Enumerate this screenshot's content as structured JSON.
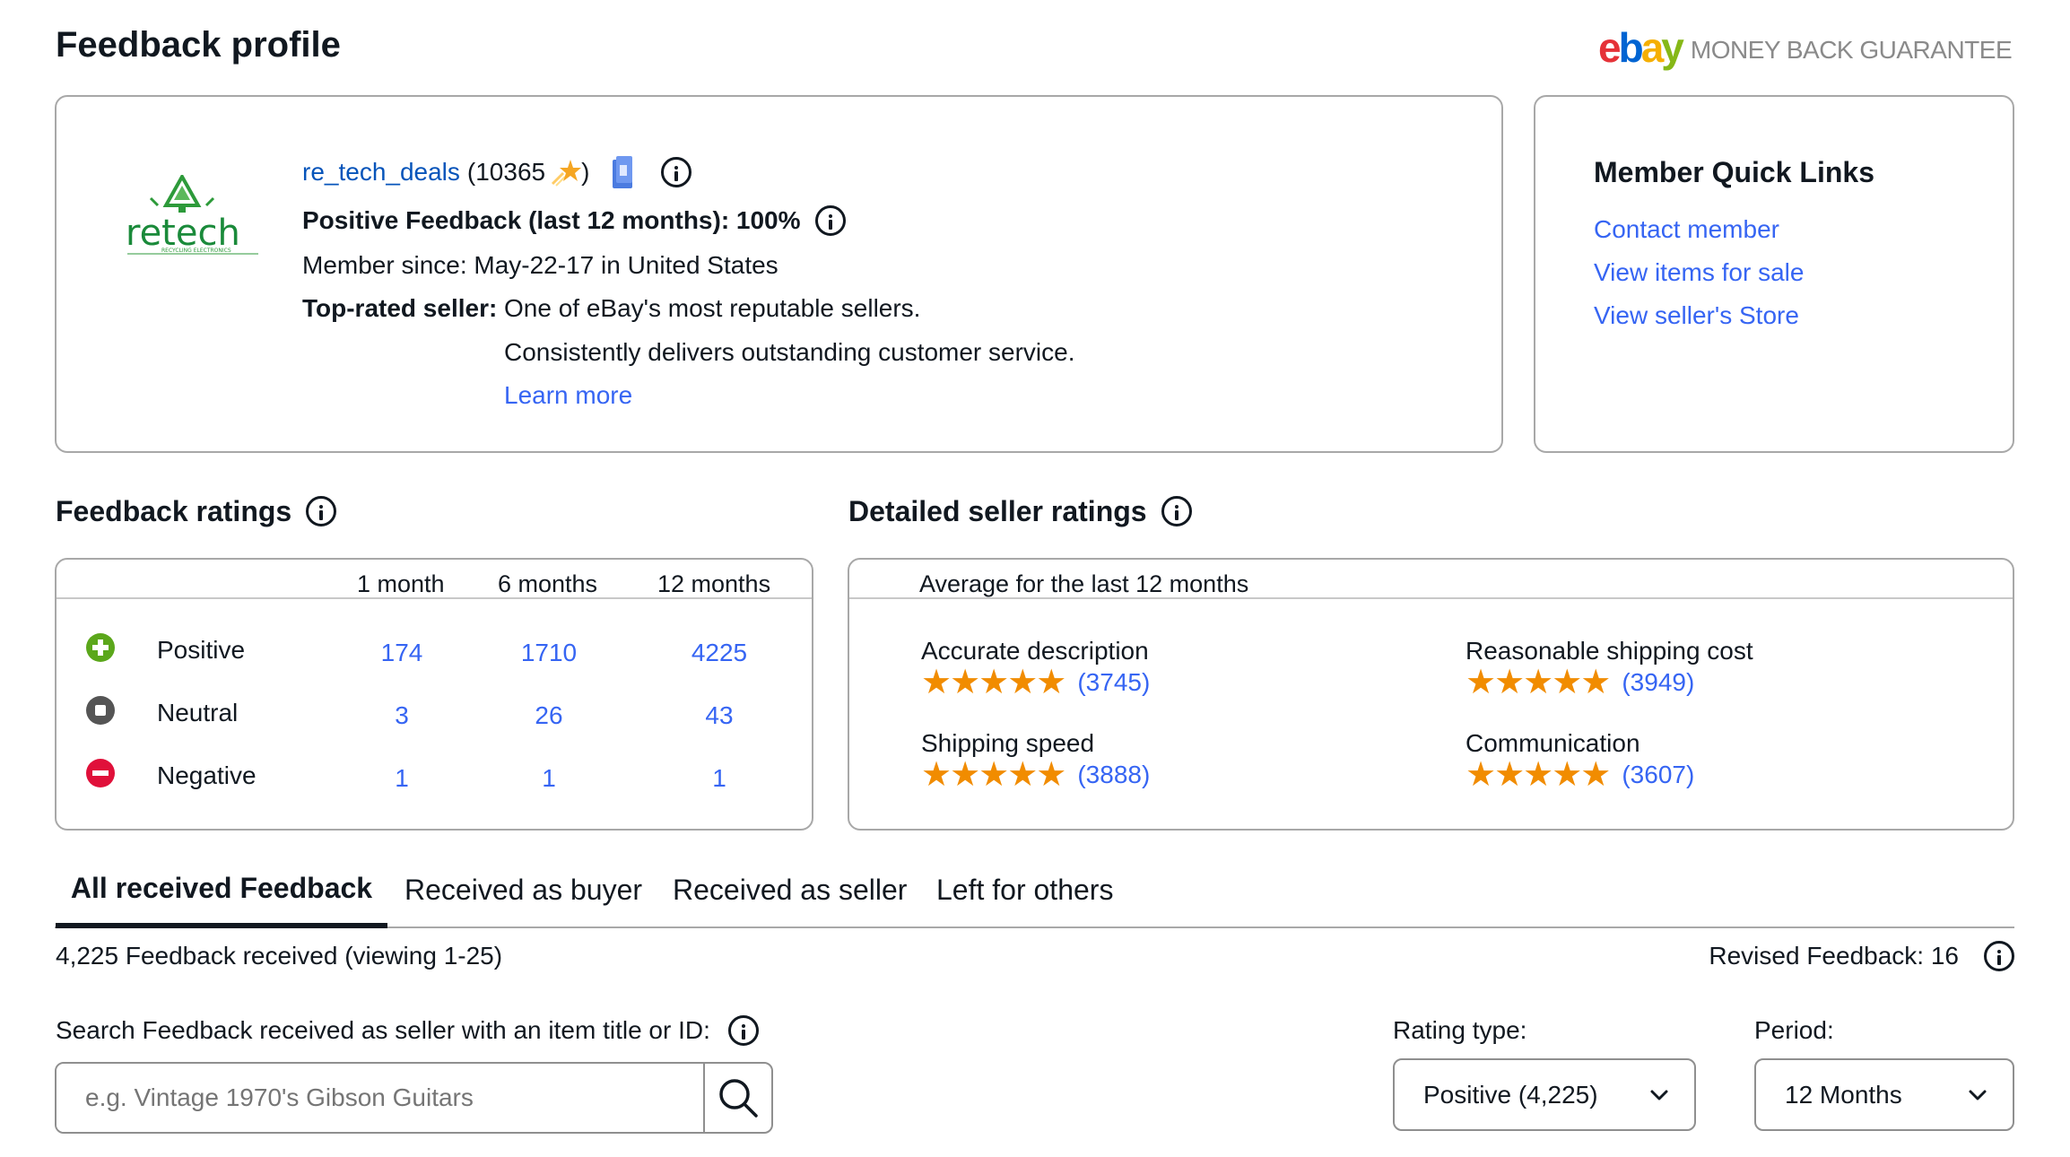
{
  "page_title": "Feedback profile",
  "banner": {
    "brand_letters": [
      "e",
      "b",
      "a",
      "y"
    ],
    "brand_colors": [
      "#e53238",
      "#0064d2",
      "#f5af02",
      "#86b817"
    ],
    "tagline": "MONEY BACK GUARANTEE"
  },
  "profile": {
    "logo_text": "retech",
    "logo_subtext": "RECYCLING ELECTRONICS",
    "username": "re_tech_deals",
    "score_open": "(10365",
    "score_close": ")",
    "positive_feedback": "Positive Feedback (last 12 months): 100%",
    "member_since": "Member since: May-22-17 in United States",
    "top_rated_label": "Top-rated seller:",
    "top_rated_line1": "One of eBay's most reputable sellers.",
    "top_rated_line2": "Consistently delivers outstanding customer service.",
    "learn_more": "Learn more"
  },
  "quick_links": {
    "title": "Member Quick Links",
    "items": [
      "Contact member",
      "View items for sale",
      "View seller's Store"
    ]
  },
  "feedback_ratings": {
    "title": "Feedback ratings",
    "columns": [
      "1 month",
      "6 months",
      "12 months"
    ],
    "rows": [
      {
        "label": "Positive",
        "values": [
          "174",
          "1710",
          "4225"
        ],
        "color": "#5ba71b"
      },
      {
        "label": "Neutral",
        "values": [
          "3",
          "26",
          "43"
        ],
        "color": "#555555"
      },
      {
        "label": "Negative",
        "values": [
          "1",
          "1",
          "1"
        ],
        "color": "#e0103a"
      }
    ]
  },
  "detailed_ratings": {
    "title": "Detailed seller ratings",
    "subtitle": "Average for the last 12 months",
    "items": [
      {
        "label": "Accurate description",
        "count": "(3745)",
        "stars": 5
      },
      {
        "label": "Reasonable shipping cost",
        "count": "(3949)",
        "stars": 5
      },
      {
        "label": "Shipping speed",
        "count": "(3888)",
        "stars": 5
      },
      {
        "label": "Communication",
        "count": "(3607)",
        "stars": 5
      }
    ]
  },
  "tabs": [
    "All received Feedback",
    "Received as buyer",
    "Received as seller",
    "Left for others"
  ],
  "summary": {
    "received": "4,225 Feedback received (viewing 1-25)",
    "revised": "Revised Feedback: 16"
  },
  "search": {
    "label": "Search Feedback received as seller with an item title or ID:",
    "placeholder": "e.g. Vintage 1970's Gibson Guitars"
  },
  "filters": {
    "rating_type_label": "Rating type:",
    "rating_type_value": "Positive (4,225)",
    "period_label": "Period:",
    "period_value": "12 Months"
  }
}
